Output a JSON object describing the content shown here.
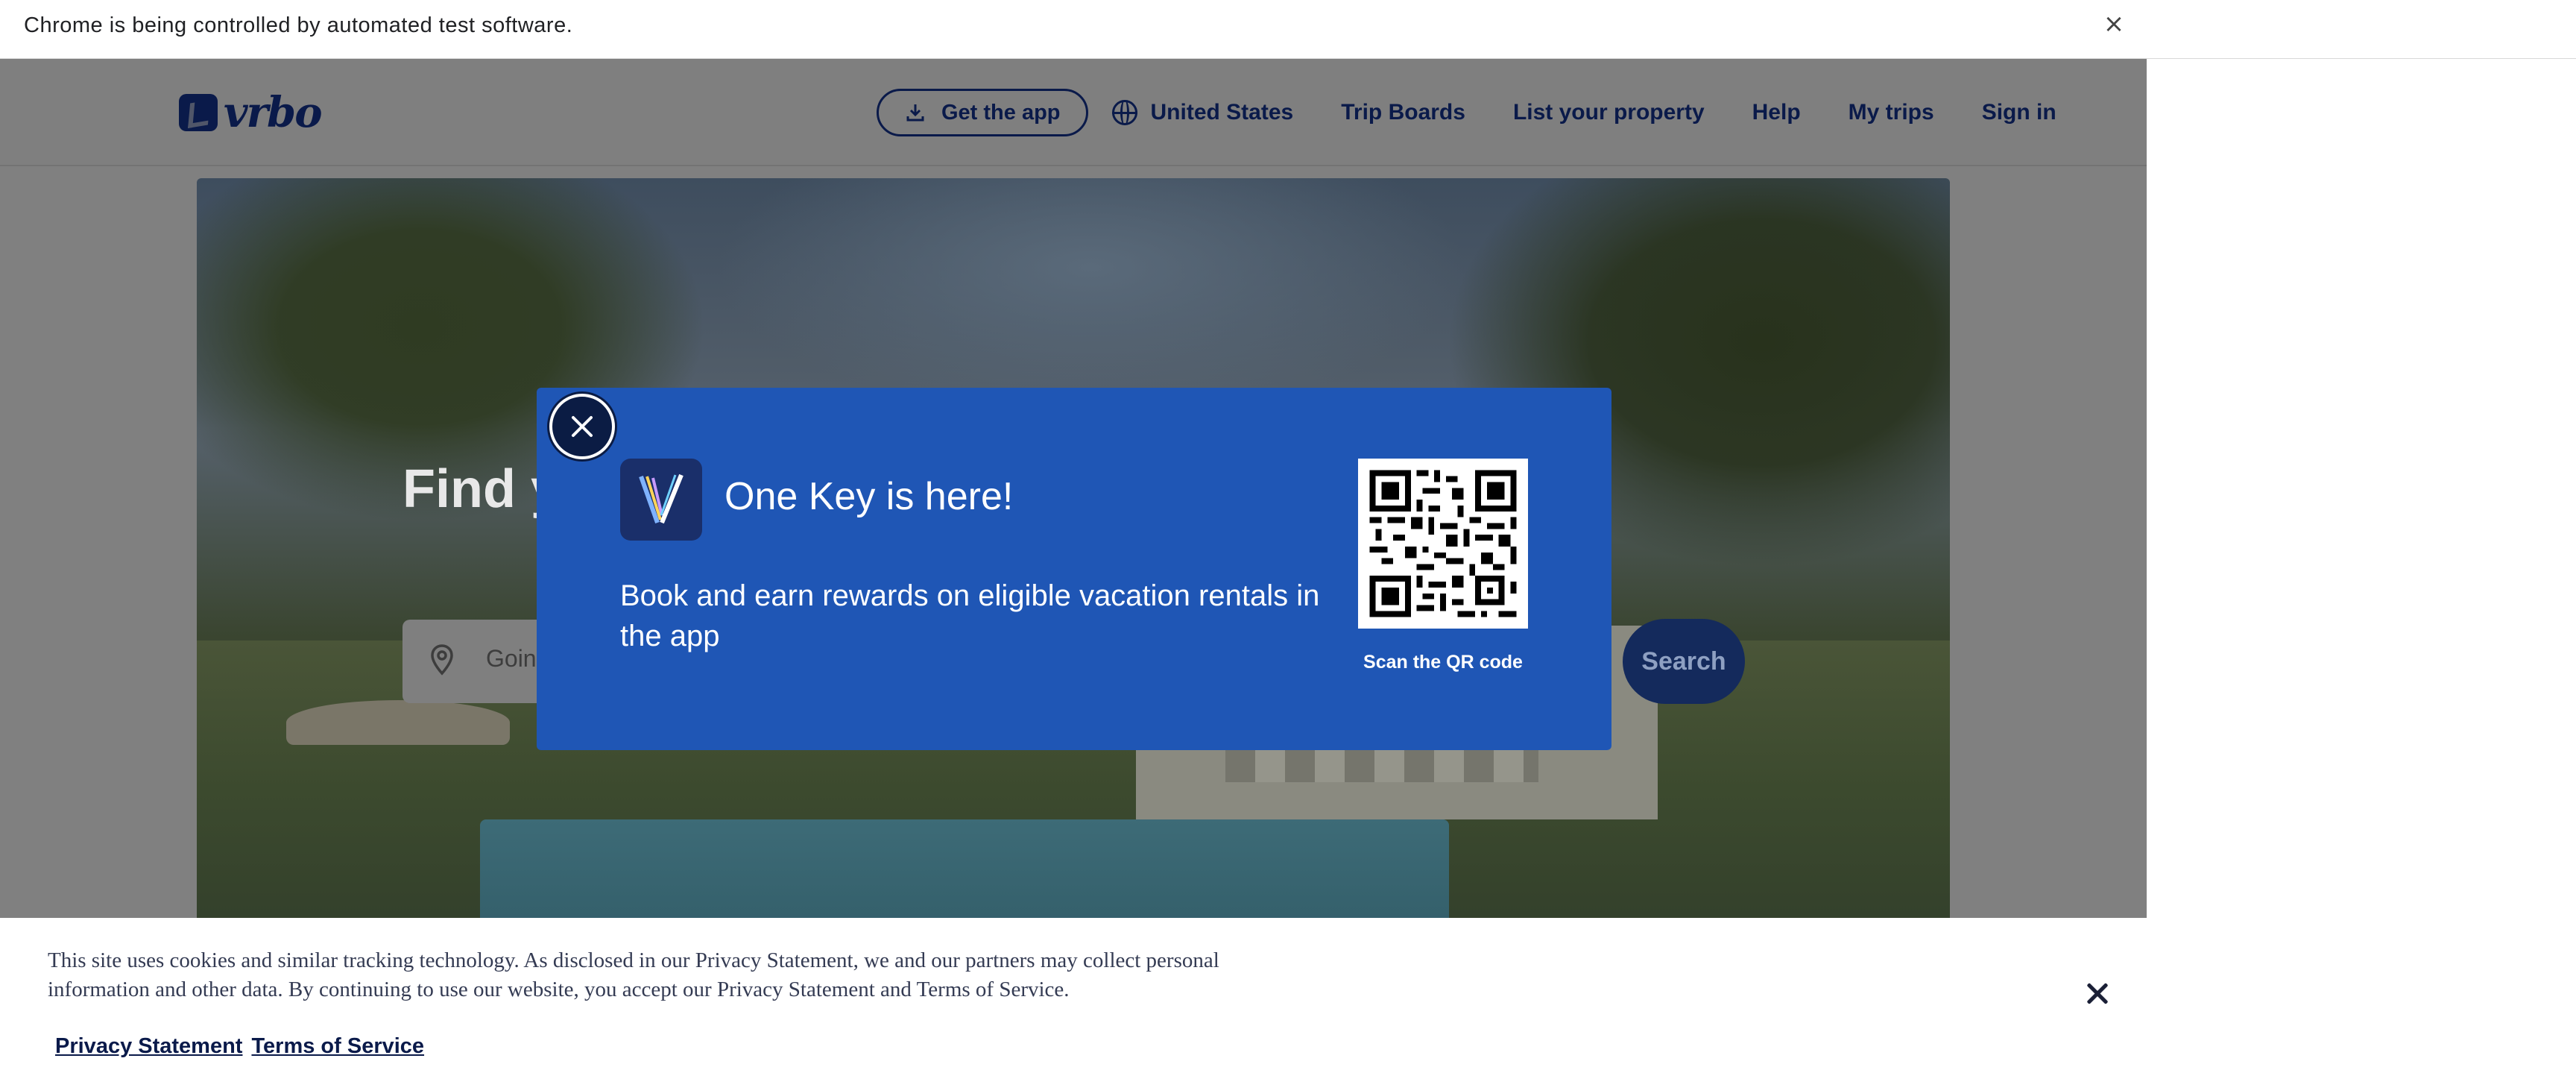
{
  "browser": {
    "infobar_text": "Chrome is being controlled by automated test software.",
    "close_glyph": "×"
  },
  "header": {
    "logo_text": "vrbo",
    "get_app_label": "Get the app",
    "region_label": "United States",
    "nav": {
      "trip_boards": "Trip Boards",
      "list_property": "List your property",
      "help": "Help",
      "my_trips": "My trips",
      "sign_in": "Sign in"
    }
  },
  "hero": {
    "title": "Find y",
    "search_placeholder": "Going",
    "search_button": "Search"
  },
  "modal": {
    "title": "One Key is here!",
    "body": "Book and earn rewards on eligible vacation rentals in the app",
    "qr_caption": "Scan the QR code"
  },
  "cookie_banner": {
    "text": "This site uses cookies and similar tracking technology. As disclosed in our Privacy Statement, we and our partners may collect personal information and other data. By continuing to use our website, you accept our Privacy Statement and Terms of Service.",
    "privacy_link": "Privacy Statement",
    "terms_link": "Terms of Service"
  },
  "colors": {
    "brand_navy": "#0a1a4a",
    "modal_blue": "#1f56b5",
    "overlay_gray": "#808080"
  }
}
